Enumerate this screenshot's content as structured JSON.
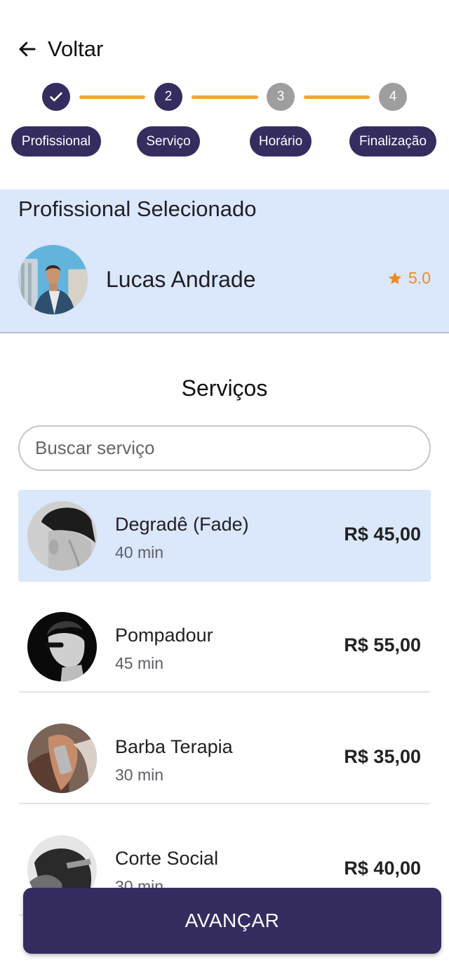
{
  "header": {
    "back_label": "Voltar"
  },
  "stepper": {
    "steps": [
      {
        "number": "",
        "label": "Profissional",
        "state": "done"
      },
      {
        "number": "2",
        "label": "Serviço",
        "state": "current"
      },
      {
        "number": "3",
        "label": "Horário",
        "state": "pending"
      },
      {
        "number": "4",
        "label": "Finalização",
        "state": "pending"
      }
    ]
  },
  "professional": {
    "section_title": "Profissional Selecionado",
    "name": "Lucas Andrade",
    "rating": "5.0"
  },
  "services": {
    "section_title": "Serviços",
    "search_placeholder": "Buscar serviço",
    "items": [
      {
        "name": "Degradê (Fade)",
        "duration": "40 min",
        "price": "R$ 45,00",
        "selected": true
      },
      {
        "name": "Pompadour",
        "duration": "45 min",
        "price": "R$ 55,00",
        "selected": false
      },
      {
        "name": "Barba Terapia",
        "duration": "30 min",
        "price": "R$ 35,00",
        "selected": false
      },
      {
        "name": "Corte Social",
        "duration": "30 min",
        "price": "R$ 40,00",
        "selected": false
      }
    ]
  },
  "footer": {
    "advance_label": "AVANÇAR"
  },
  "colors": {
    "primary": "#352c5f",
    "accent_line": "#f3a43a",
    "highlight_bg": "#dbe7fb",
    "rating": "#f08a23"
  }
}
